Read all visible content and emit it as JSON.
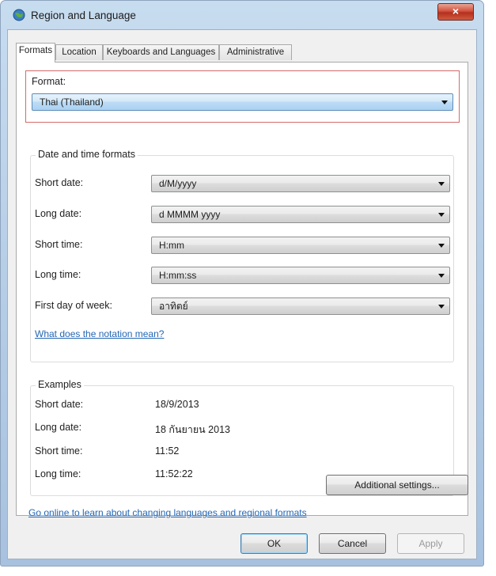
{
  "window": {
    "title": "Region and Language",
    "close_glyph": "×"
  },
  "tabs": [
    {
      "label": "Formats",
      "active": true
    },
    {
      "label": "Location",
      "active": false
    },
    {
      "label": "Keyboards and Languages",
      "active": false
    },
    {
      "label": "Administrative",
      "active": false
    }
  ],
  "format": {
    "label": "Format:",
    "value": "Thai (Thailand)"
  },
  "datetime": {
    "title": "Date and time formats",
    "rows": [
      {
        "label": "Short date:",
        "value": "d/M/yyyy"
      },
      {
        "label": "Long date:",
        "value": "d MMMM yyyy"
      },
      {
        "label": "Short time:",
        "value": "H:mm"
      },
      {
        "label": "Long time:",
        "value": "H:mm:ss"
      },
      {
        "label": "First day of week:",
        "value": "อาทิตย์"
      }
    ],
    "notation_link": "What does the notation mean?"
  },
  "examples": {
    "title": "Examples",
    "rows": [
      {
        "label": "Short date:",
        "value": "18/9/2013"
      },
      {
        "label": "Long date:",
        "value": "18 กันยายน 2013"
      },
      {
        "label": "Short time:",
        "value": "11:52"
      },
      {
        "label": "Long time:",
        "value": "11:52:22"
      }
    ]
  },
  "additional_settings_label": "Additional settings...",
  "online_link": "Go online to learn about changing languages and regional formats",
  "buttons": {
    "ok": "OK",
    "cancel": "Cancel",
    "apply": "Apply"
  },
  "colors": {
    "format_box_border": "#d46a6a",
    "link": "#2567b4",
    "selected_combo": "#bedcf5"
  }
}
